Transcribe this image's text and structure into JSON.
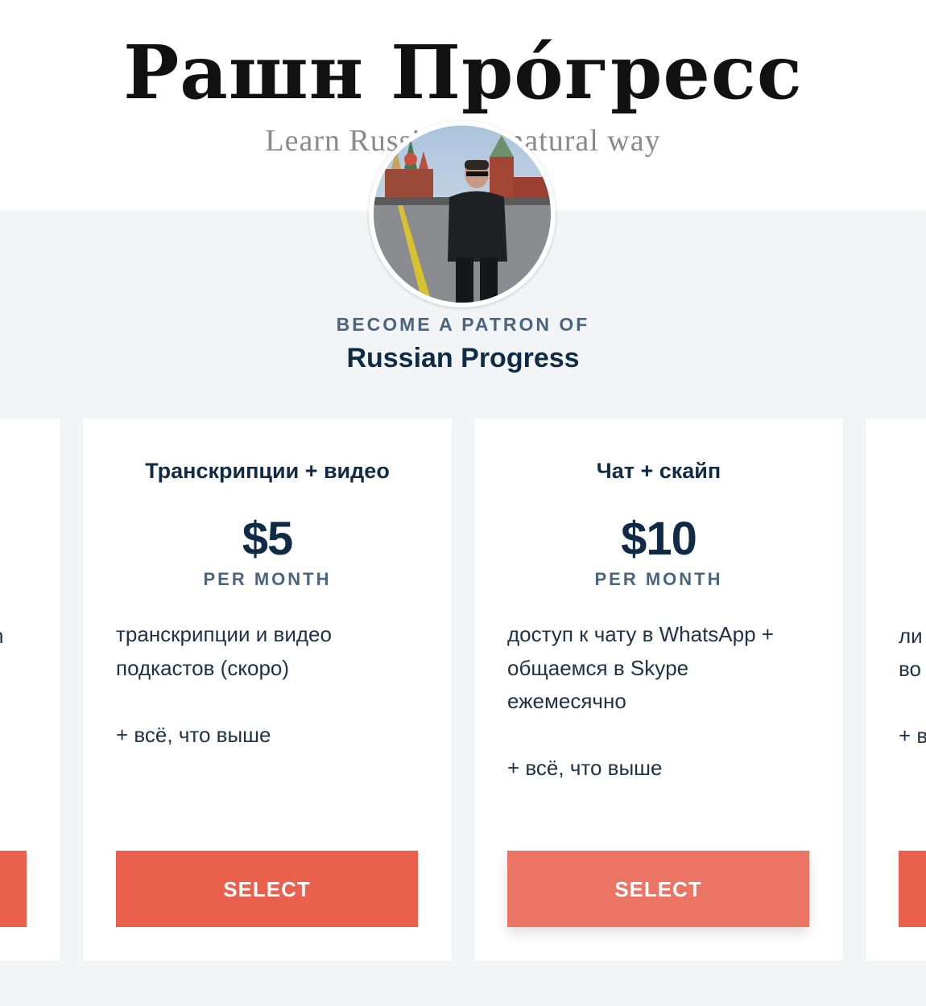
{
  "banner": {
    "title": "Рашн Прóгресс",
    "subtitle": "Learn Russian the natural way"
  },
  "creator": {
    "become_label": "BECOME A PATRON OF",
    "name": "Russian Progress"
  },
  "tiers": [
    {
      "title": "Транскрипции + видео",
      "price": "$5",
      "period": "PER MONTH",
      "desc_lines": [
        "транскрипции и видео",
        "подкастов (скоро)"
      ],
      "extra": "+ всё, что выше",
      "button": "SELECT"
    },
    {
      "title": "Чат + скайп",
      "price": "$10",
      "period": "PER MONTH",
      "desc_lines": [
        "доступ к чату в WhatsApp +",
        "общаемся в Skype",
        "ежемесячно"
      ],
      "extra": "+ всё, что выше",
      "button": "SELECT"
    }
  ],
  "left_partial": {
    "text": "n"
  },
  "right_partial": {
    "line1": "ли",
    "line2": "во",
    "line3": "+ в"
  },
  "colors": {
    "accent": "#e9604d",
    "text_dark": "#0f2b46",
    "text_muted": "#4a6580",
    "background": "#f2f4f5"
  }
}
